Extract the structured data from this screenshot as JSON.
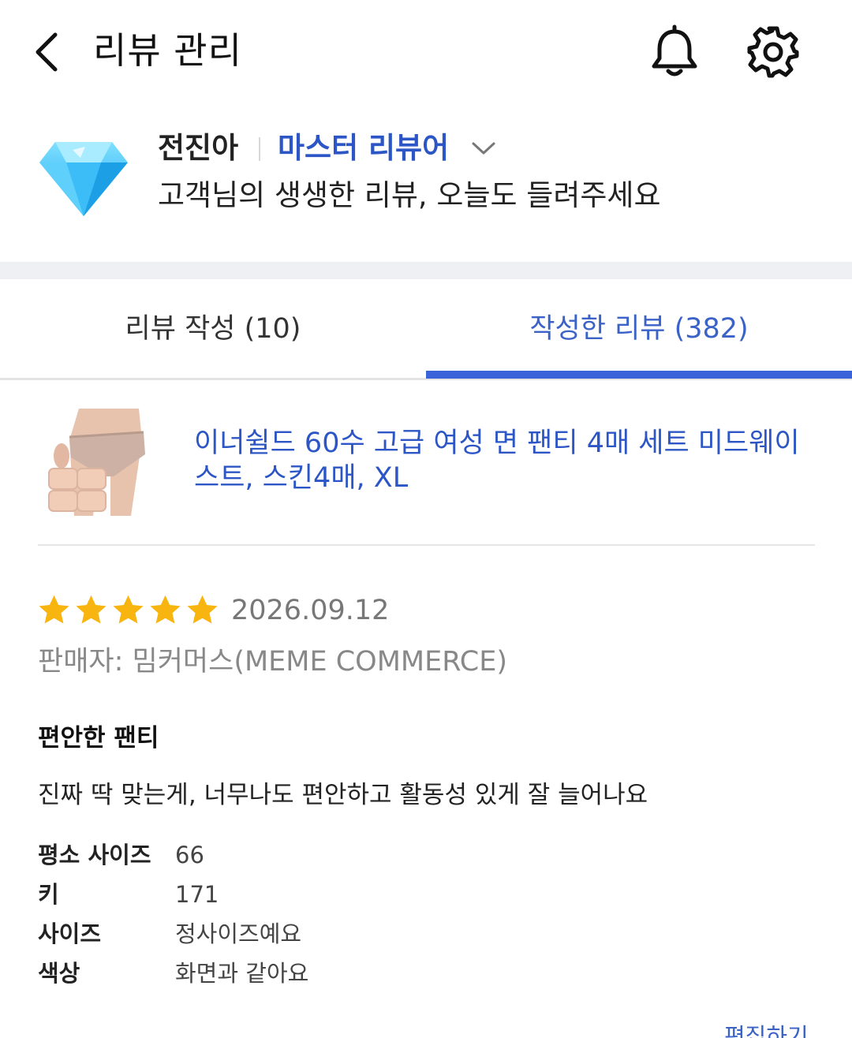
{
  "header": {
    "title": "리뷰 관리",
    "back_icon": "chevron-left-icon",
    "notification_icon": "bell-icon",
    "settings_icon": "gear-icon"
  },
  "profile": {
    "name": "전진아",
    "grade": "마스터 리뷰어",
    "tagline": "고객님의 생생한 리뷰, 오늘도 들려주세요",
    "badge_icon": "diamond-icon"
  },
  "tabs": [
    {
      "label": "리뷰 작성 (10)",
      "active": false
    },
    {
      "label": "작성한 리뷰 (382)",
      "active": true
    }
  ],
  "review": {
    "product_name": "이너쉴드 60수 고급 여성 면 팬티 4매 세트 미드웨이스트, 스킨4매, XL",
    "rating": 5,
    "date": "2026.09.12",
    "seller": "판매자: 밈커머스(MEME COMMERCE)",
    "title": "편안한 팬티",
    "body": "진짜 딱 맞는게, 너무나도 편안하고 활동성 있게 잘 늘어나요",
    "attributes": [
      {
        "label": "평소 사이즈",
        "value": "66"
      },
      {
        "label": "키",
        "value": "171"
      },
      {
        "label": "사이즈",
        "value": "정사이즈예요"
      },
      {
        "label": "색상",
        "value": "화면과 같아요"
      }
    ],
    "edit_label": "편집하기"
  },
  "colors": {
    "accent": "#3a62d9",
    "link": "#2c56c6",
    "star": "#f8b40f",
    "band": "#eef0f3"
  }
}
